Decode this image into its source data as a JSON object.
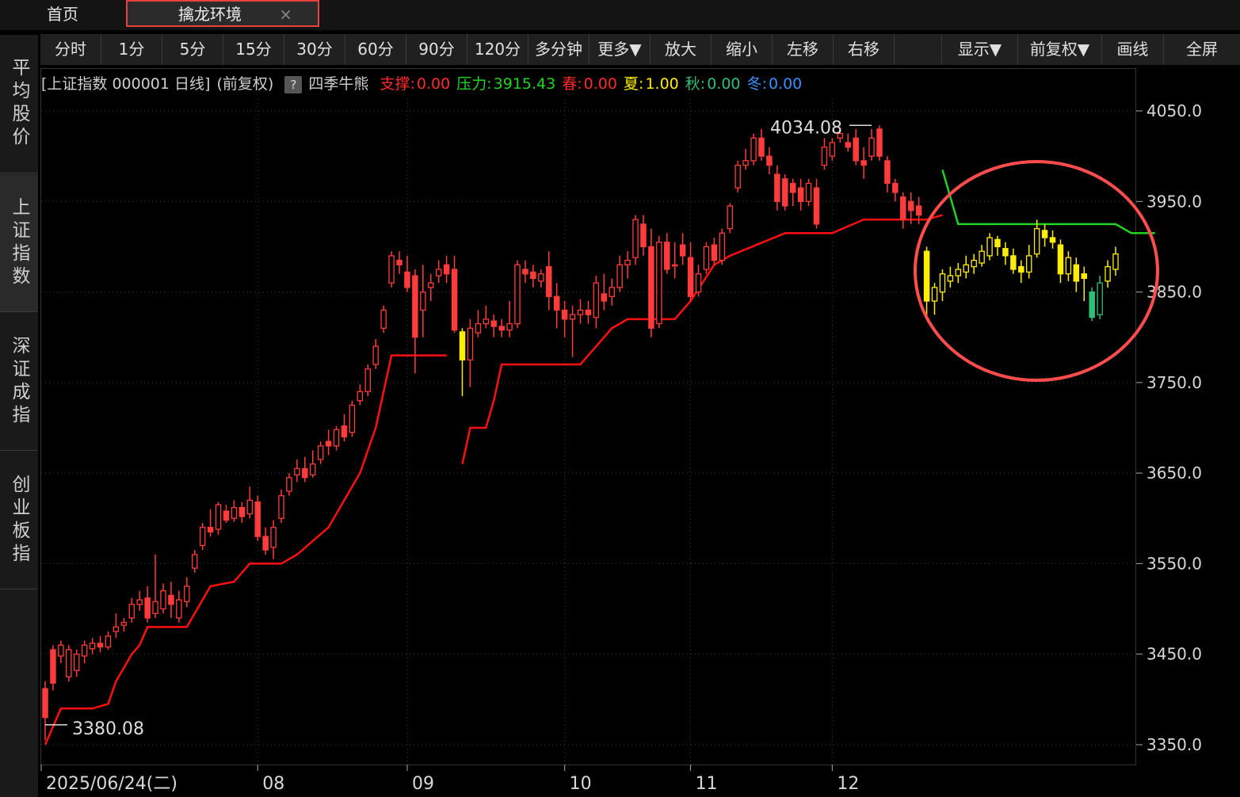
{
  "tabs": {
    "home_label": "首页",
    "active_label": "擒龙环境",
    "close_glyph": "×"
  },
  "sidebar": {
    "items": [
      {
        "label": "平均股价"
      },
      {
        "label": "上证指数",
        "active": true
      },
      {
        "label": "深证成指"
      },
      {
        "label": "创业板指"
      }
    ]
  },
  "toolbar": {
    "buttons": [
      "分时",
      "1分",
      "5分",
      "15分",
      "30分",
      "60分",
      "90分",
      "120分",
      "多分钟",
      "更多▼",
      "放大",
      "缩小",
      "左移",
      "右移",
      "",
      "显示▼",
      "前复权▼",
      "画线",
      "全屏"
    ]
  },
  "info": {
    "title": "[上证指数 000001 日线]",
    "adjust": "(前复权)",
    "help": "?",
    "indicator": "四季牛熊",
    "support_label": "支撑:",
    "support_value": "0.00",
    "pressure_label": "压力:",
    "pressure_value": "3915.43",
    "spring_label": "春:",
    "spring_value": "0.00",
    "summer_label": "夏:",
    "summer_value": "1.00",
    "autumn_label": "秋:",
    "autumn_value": "0.00",
    "winter_label": "冬:",
    "winter_value": "0.00"
  },
  "colors": {
    "up": "#ff3b3b",
    "down": "#ff3b3b",
    "yellow": "#ffee00",
    "green_candle": "#2fbf7a",
    "support_line": "#ff1010",
    "pressure_line": "#22d322",
    "highlight_circle": "#ff4d4d",
    "grid": "#3a3a3a"
  },
  "chart_data": {
    "type": "candlestick",
    "ylim": [
      3330,
      4080
    ],
    "yticks": [
      "4050.0",
      "3950.0",
      "3850.0",
      "3750.0",
      "3650.0",
      "3550.0",
      "3450.0",
      "3350.0"
    ],
    "ytick_values": [
      4050,
      3950,
      3850,
      3750,
      3650,
      3550,
      3450,
      3350
    ],
    "xlabels": [
      "2025/06/24(二)",
      "08",
      "09",
      "10",
      "11",
      "12"
    ],
    "xlabel_index": [
      0,
      27,
      46,
      66,
      82,
      100
    ],
    "max_label": "4034.08",
    "min_label": "3380.08",
    "candles": [
      [
        3412,
        3380,
        3420,
        3355,
        "r"
      ],
      [
        3455,
        3418,
        3460,
        3410,
        "r"
      ],
      [
        3448,
        3460,
        3465,
        3440,
        "r"
      ],
      [
        3425,
        3455,
        3460,
        3420,
        "r"
      ],
      [
        3432,
        3450,
        3455,
        3425,
        "r"
      ],
      [
        3448,
        3460,
        3465,
        3440,
        "r"
      ],
      [
        3456,
        3462,
        3468,
        3450,
        "r"
      ],
      [
        3462,
        3458,
        3470,
        3452,
        "r"
      ],
      [
        3458,
        3470,
        3475,
        3455,
        "r"
      ],
      [
        3475,
        3480,
        3495,
        3468,
        "r"
      ],
      [
        3482,
        3485,
        3490,
        3475,
        "r"
      ],
      [
        3490,
        3505,
        3512,
        3485,
        "r"
      ],
      [
        3505,
        3510,
        3520,
        3498,
        "r"
      ],
      [
        3512,
        3490,
        3525,
        3485,
        "r"
      ],
      [
        3495,
        3508,
        3560,
        3490,
        "r"
      ],
      [
        3500,
        3520,
        3528,
        3495,
        "r"
      ],
      [
        3515,
        3505,
        3530,
        3490,
        "r"
      ],
      [
        3490,
        3510,
        3520,
        3485,
        "r"
      ],
      [
        3508,
        3525,
        3535,
        3502,
        "r"
      ],
      [
        3545,
        3560,
        3565,
        3540,
        "r"
      ],
      [
        3570,
        3590,
        3595,
        3565,
        "r"
      ],
      [
        3590,
        3585,
        3610,
        3580,
        "r"
      ],
      [
        3588,
        3615,
        3618,
        3582,
        "r"
      ],
      [
        3608,
        3598,
        3615,
        3595,
        "r"
      ],
      [
        3600,
        3612,
        3620,
        3596,
        "r"
      ],
      [
        3612,
        3602,
        3618,
        3595,
        "r"
      ],
      [
        3605,
        3620,
        3635,
        3600,
        "r"
      ],
      [
        3618,
        3580,
        3625,
        3575,
        "r"
      ],
      [
        3580,
        3565,
        3590,
        3560,
        "r"
      ],
      [
        3568,
        3590,
        3598,
        3555,
        "r"
      ],
      [
        3600,
        3625,
        3632,
        3595,
        "r"
      ],
      [
        3630,
        3645,
        3650,
        3625,
        "r"
      ],
      [
        3648,
        3655,
        3665,
        3640,
        "r"
      ],
      [
        3655,
        3645,
        3668,
        3640,
        "r"
      ],
      [
        3648,
        3660,
        3675,
        3645,
        "r"
      ],
      [
        3665,
        3680,
        3685,
        3660,
        "r"
      ],
      [
        3685,
        3680,
        3698,
        3670,
        "r"
      ],
      [
        3680,
        3698,
        3702,
        3675,
        "r"
      ],
      [
        3702,
        3690,
        3715,
        3685,
        "r"
      ],
      [
        3695,
        3725,
        3730,
        3690,
        "r"
      ],
      [
        3730,
        3740,
        3748,
        3725,
        "r"
      ],
      [
        3740,
        3765,
        3770,
        3735,
        "r"
      ],
      [
        3770,
        3790,
        3798,
        3765,
        "r"
      ],
      [
        3810,
        3830,
        3835,
        3805,
        "r"
      ],
      [
        3860,
        3890,
        3895,
        3855,
        "r"
      ],
      [
        3885,
        3880,
        3895,
        3870,
        "r"
      ],
      [
        3872,
        3855,
        3890,
        3850,
        "r"
      ],
      [
        3868,
        3800,
        3875,
        3760,
        "r"
      ],
      [
        3830,
        3850,
        3880,
        3800,
        "r"
      ],
      [
        3855,
        3860,
        3870,
        3840,
        "r"
      ],
      [
        3868,
        3875,
        3885,
        3860,
        "r"
      ],
      [
        3880,
        3870,
        3890,
        3860,
        "r"
      ],
      [
        3875,
        3808,
        3890,
        3805,
        "r"
      ],
      [
        3806,
        3775,
        3810,
        3735,
        "y"
      ],
      [
        3775,
        3810,
        3820,
        3745,
        "r"
      ],
      [
        3805,
        3815,
        3830,
        3800,
        "r"
      ],
      [
        3815,
        3820,
        3835,
        3810,
        "r"
      ],
      [
        3818,
        3812,
        3825,
        3800,
        "r"
      ],
      [
        3812,
        3808,
        3820,
        3800,
        "r"
      ],
      [
        3808,
        3815,
        3840,
        3800,
        "r"
      ],
      [
        3815,
        3880,
        3885,
        3810,
        "r"
      ],
      [
        3875,
        3870,
        3885,
        3860,
        "r"
      ],
      [
        3872,
        3865,
        3880,
        3855,
        "r"
      ],
      [
        3862,
        3870,
        3875,
        3855,
        "r"
      ],
      [
        3878,
        3845,
        3895,
        3830,
        "r"
      ],
      [
        3845,
        3830,
        3860,
        3810,
        "r"
      ],
      [
        3830,
        3820,
        3840,
        3800,
        "r"
      ],
      [
        3820,
        3825,
        3835,
        3778,
        "r"
      ],
      [
        3825,
        3830,
        3842,
        3815,
        "r"
      ],
      [
        3830,
        3825,
        3840,
        3815,
        "r"
      ],
      [
        3822,
        3860,
        3868,
        3810,
        "r"
      ],
      [
        3848,
        3840,
        3870,
        3830,
        "r"
      ],
      [
        3845,
        3855,
        3865,
        3835,
        "r"
      ],
      [
        3855,
        3880,
        3890,
        3850,
        "r"
      ],
      [
        3880,
        3885,
        3895,
        3865,
        "r"
      ],
      [
        3888,
        3930,
        3935,
        3880,
        "r"
      ],
      [
        3925,
        3900,
        3935,
        3890,
        "r"
      ],
      [
        3900,
        3810,
        3920,
        3800,
        "r"
      ],
      [
        3815,
        3905,
        3912,
        3810,
        "r"
      ],
      [
        3905,
        3875,
        3915,
        3870,
        "r"
      ],
      [
        3880,
        3880,
        3905,
        3865,
        "r"
      ],
      [
        3902,
        3890,
        3915,
        3880,
        "r"
      ],
      [
        3888,
        3845,
        3905,
        3840,
        "r"
      ],
      [
        3850,
        3870,
        3880,
        3845,
        "r"
      ],
      [
        3875,
        3900,
        3905,
        3870,
        "r"
      ],
      [
        3902,
        3885,
        3910,
        3880,
        "r"
      ],
      [
        3885,
        3915,
        3920,
        3880,
        "r"
      ],
      [
        3920,
        3945,
        3948,
        3915,
        "r"
      ],
      [
        3965,
        3990,
        3995,
        3960,
        "r"
      ],
      [
        3990,
        3995,
        4008,
        3985,
        "r"
      ],
      [
        3995,
        4020,
        4025,
        3990,
        "r"
      ],
      [
        4020,
        4000,
        4030,
        3995,
        "r"
      ],
      [
        4000,
        3990,
        4010,
        3980,
        "r"
      ],
      [
        3980,
        3950,
        3990,
        3940,
        "r"
      ],
      [
        3975,
        3945,
        3980,
        3940,
        "r"
      ],
      [
        3970,
        3960,
        3975,
        3945,
        "r"
      ],
      [
        3965,
        3950,
        3975,
        3940,
        "r"
      ],
      [
        3950,
        3970,
        3975,
        3945,
        "r"
      ],
      [
        3965,
        3925,
        3975,
        3920,
        "r"
      ],
      [
        3990,
        4010,
        4020,
        3985,
        "r"
      ],
      [
        4000,
        4015,
        4020,
        3995,
        "r"
      ],
      [
        4020,
        4025,
        4030,
        4015,
        "r"
      ],
      [
        4015,
        4010,
        4025,
        4005,
        "r"
      ],
      [
        4020,
        3995,
        4030,
        3990,
        "r"
      ],
      [
        3995,
        3990,
        4010,
        3975,
        "r"
      ],
      [
        4000,
        4020,
        4030,
        3995,
        "r"
      ],
      [
        4030,
        4000,
        4034,
        3995,
        "r"
      ],
      [
        3995,
        3970,
        4000,
        3960,
        "r"
      ],
      [
        3970,
        3960,
        3975,
        3950,
        "r"
      ],
      [
        3955,
        3930,
        3960,
        3920,
        "r"
      ],
      [
        3950,
        3940,
        3960,
        3925,
        "r"
      ],
      [
        3945,
        3935,
        3955,
        3925,
        "r"
      ],
      [
        3895,
        3840,
        3900,
        3820,
        "y"
      ],
      [
        3840,
        3855,
        3860,
        3825,
        "y"
      ],
      [
        3850,
        3870,
        3875,
        3840,
        "y"
      ],
      [
        3862,
        3868,
        3878,
        3855,
        "y"
      ],
      [
        3868,
        3875,
        3882,
        3860,
        "y"
      ],
      [
        3872,
        3880,
        3890,
        3865,
        "y"
      ],
      [
        3878,
        3885,
        3892,
        3870,
        "y"
      ],
      [
        3882,
        3895,
        3902,
        3878,
        "y"
      ],
      [
        3890,
        3910,
        3915,
        3885,
        "y"
      ],
      [
        3908,
        3900,
        3912,
        3890,
        "y"
      ],
      [
        3898,
        3890,
        3905,
        3880,
        "y"
      ],
      [
        3890,
        3875,
        3898,
        3870,
        "y"
      ],
      [
        3878,
        3872,
        3885,
        3860,
        "y"
      ],
      [
        3872,
        3890,
        3902,
        3865,
        "y"
      ],
      [
        3892,
        3920,
        3930,
        3888,
        "y"
      ],
      [
        3918,
        3910,
        3925,
        3900,
        "y"
      ],
      [
        3910,
        3905,
        3918,
        3898,
        "y"
      ],
      [
        3902,
        3870,
        3908,
        3860,
        "y"
      ],
      [
        3870,
        3888,
        3895,
        3862,
        "y"
      ],
      [
        3880,
        3862,
        3888,
        3850,
        "y"
      ],
      [
        3870,
        3865,
        3878,
        3840,
        "y"
      ],
      [
        3850,
        3822,
        3855,
        3818,
        "g"
      ],
      [
        3825,
        3860,
        3868,
        3820,
        "g"
      ],
      [
        3862,
        3878,
        3885,
        3855,
        "y"
      ],
      [
        3875,
        3892,
        3900,
        3868,
        "y"
      ]
    ]
  }
}
